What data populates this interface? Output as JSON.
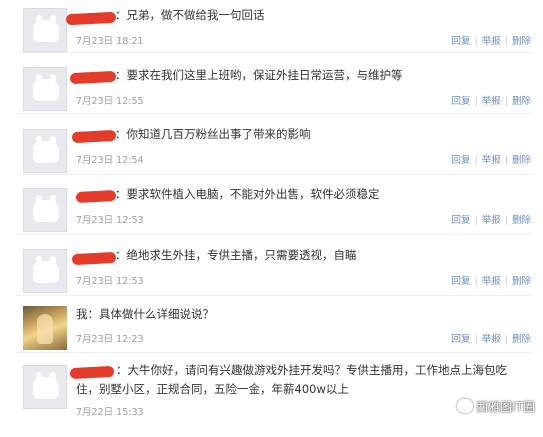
{
  "actions": {
    "reply": "回复",
    "report": "举报",
    "delete": "删除",
    "sep": "|"
  },
  "messages": [
    {
      "text": "：兄弟，做不做给我一句回话",
      "date": "7月23日 18:21"
    },
    {
      "text": "：要求在我们这里上班哟，保证外挂日常运营，与维护等",
      "date": "7月23日 12:55"
    },
    {
      "text": "：你知道几百万粉丝出事了带来的影响",
      "date": "7月23日 12:54"
    },
    {
      "text": "：要求软件植入电脑，不能对外出售，软件必须稳定",
      "date": "7月23日 12:53"
    },
    {
      "text": "：绝地求生外挂，专供主播，只需要透视，自瞄",
      "date": "7月23日 12:53"
    },
    {
      "text": "我：具体做什么详细说说？",
      "date": "7月23日 12:23"
    },
    {
      "text": "：大牛你好，请问有兴趣做游戏外挂开发吗？专供主播用，工作地点上海包吃住，别墅小区，正规合同，五险一金，年薪400w以上",
      "date": "7月22日 15:33"
    }
  ],
  "watermark": "西雅图IT圈"
}
